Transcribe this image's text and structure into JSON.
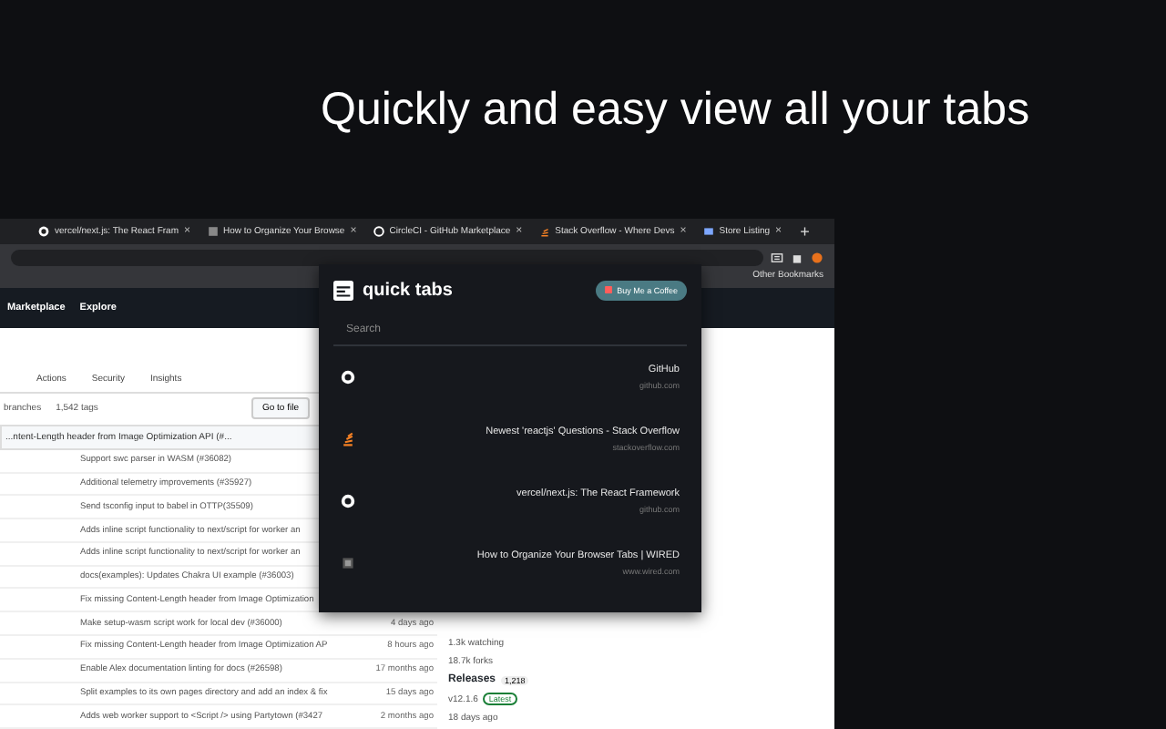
{
  "headline": "Quickly and easy view all your tabs",
  "browser": {
    "tabs": [
      {
        "title": "vercel/next.js: The React Fram",
        "kind": "github",
        "close": "×"
      },
      {
        "title": "How to Organize Your Browse",
        "kind": "page",
        "close": "×"
      },
      {
        "title": "CircleCI - GitHub Marketplace",
        "kind": "circle",
        "close": "×"
      },
      {
        "title": "Stack Overflow - Where Devs",
        "kind": "stack",
        "close": "×"
      },
      {
        "title": "Store Listing",
        "kind": "store",
        "close": "×"
      }
    ],
    "new_tab": "+",
    "bookmarks": "Other Bookmarks"
  },
  "github": {
    "nav": [
      "Marketplace",
      "Explore"
    ],
    "repo_tabs": [
      "Actions",
      "Security",
      "Insights"
    ],
    "branches": "branches",
    "tags": "1,542 tags",
    "go_to_file": "Go to file",
    "latest_commit": "...ntent-Length header from Image Optimization API (#...",
    "commits": [
      {
        "message": "Support swc parser in WASM (#36082)"
      },
      {
        "message": "Additional telemetry improvements (#35927)"
      },
      {
        "message": "Send tsconfig input to babel in OTTP(35509)"
      },
      {
        "message": "Adds inline script functionality to next/script for worker an"
      },
      {
        "message": "Adds inline script functionality to next/script for worker an"
      },
      {
        "message": "docs(examples): Updates Chakra UI example (#36003)"
      },
      {
        "message": "Fix missing Content-Length header from Image Optimization"
      },
      {
        "message": "Make setup-wasm script work for local dev (#36000)",
        "time": "4 days ago"
      },
      {
        "message": "Fix missing Content-Length header from Image Optimization AP",
        "time": "8 hours ago"
      },
      {
        "message": "Enable Alex documentation linting for docs (#26598)",
        "time": "17 months ago"
      },
      {
        "message": "Split examples to its own pages directory and add an index & fix",
        "time": "15 days ago"
      },
      {
        "message": "Adds web worker support to <Script /> using Partytown (#3427",
        "time": "2 months ago"
      }
    ],
    "sidebar": {
      "watching": "1.3k watching",
      "forks": "18.7k forks",
      "releases": "Releases",
      "release_count": "1,218",
      "version": "v12.1.6",
      "latest": "Latest",
      "released": "18 days ago"
    }
  },
  "popup": {
    "title": "quick tabs",
    "coffee_button": "Buy Me a Coffee",
    "search": {
      "placeholder": "Search"
    },
    "items": [
      {
        "title": "GitHub",
        "url": "github.com",
        "kind": "github"
      },
      {
        "title": "Newest 'reactjs' Questions - Stack Overflow",
        "url": "stackoverflow.com",
        "kind": "stack"
      },
      {
        "title": "vercel/next.js: The React Framework",
        "url": "github.com",
        "kind": "github"
      },
      {
        "title": "How to Organize Your Browser Tabs | WIRED",
        "url": "www.wired.com",
        "kind": "page"
      }
    ]
  }
}
